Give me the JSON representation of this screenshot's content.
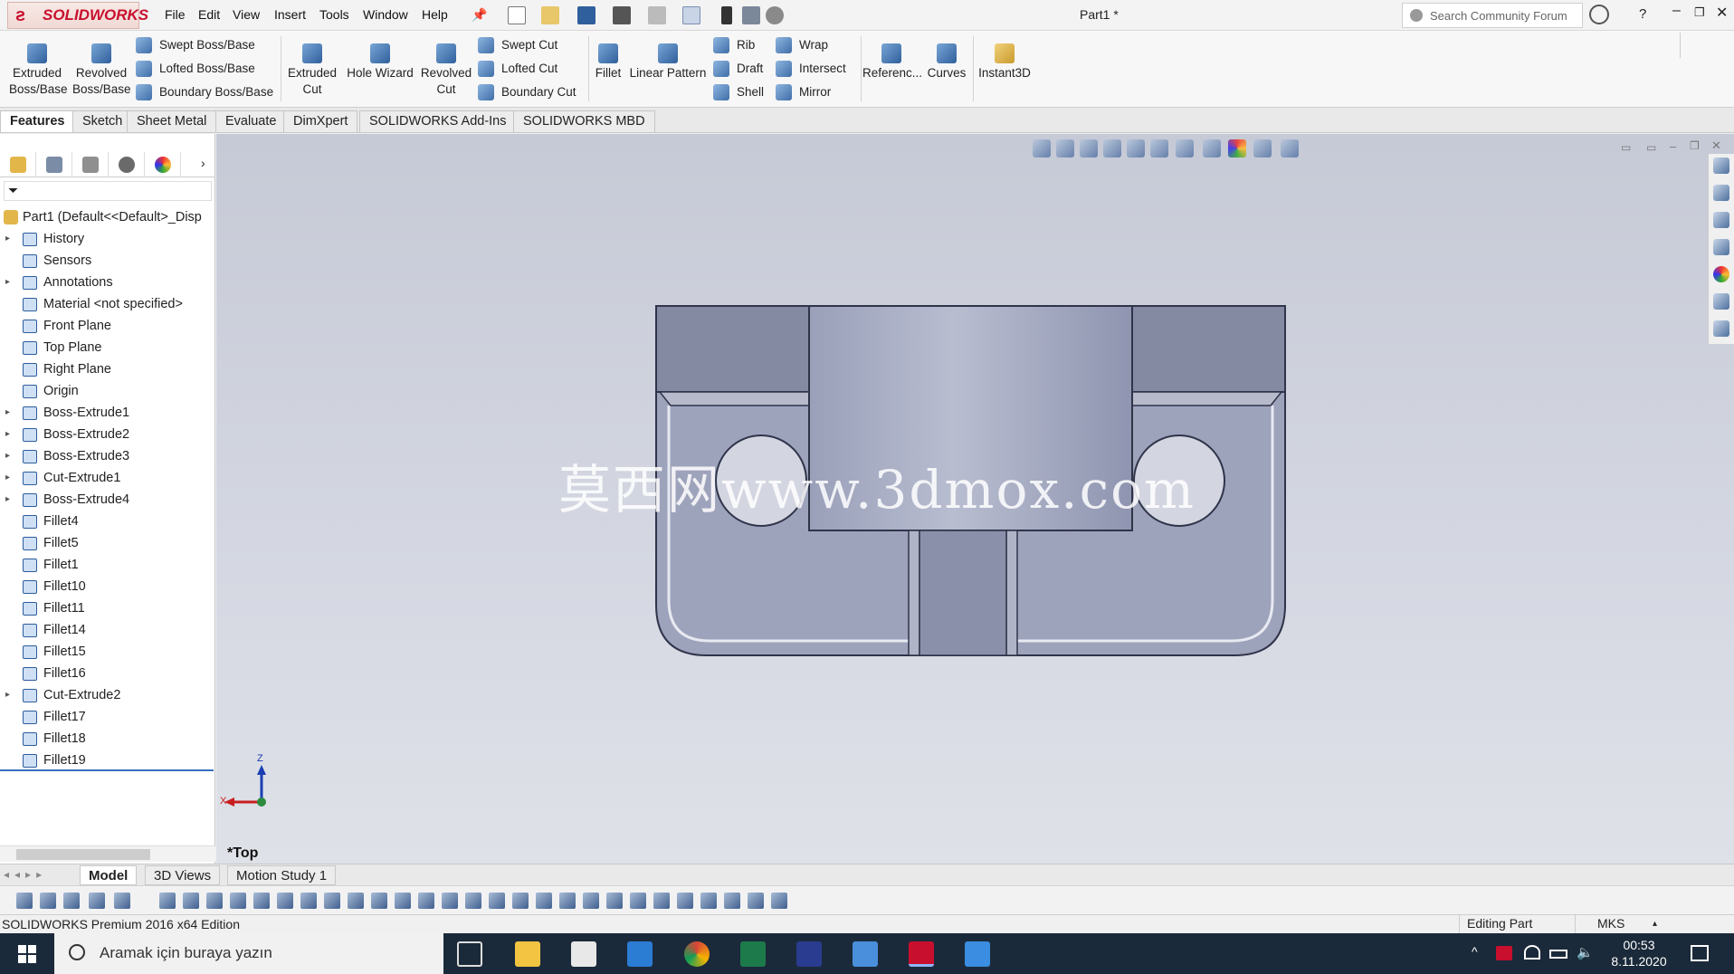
{
  "app": {
    "logo_text": "SOLIDWORKS",
    "document_title": "Part1 *",
    "menu": [
      "File",
      "Edit",
      "View",
      "Insert",
      "Tools",
      "Window",
      "Help"
    ],
    "search_placeholder": "Search Community Forum",
    "help_label": "?"
  },
  "command_manager": {
    "extruded_boss": "Extruded\nBoss/Base",
    "revolved_boss": "Revolved\nBoss/Base",
    "swept_boss": "Swept Boss/Base",
    "lofted_boss": "Lofted Boss/Base",
    "boundary_boss": "Boundary Boss/Base",
    "extruded_cut": "Extruded\nCut",
    "hole_wizard": "Hole Wizard",
    "revolved_cut": "Revolved\nCut",
    "swept_cut": "Swept Cut",
    "lofted_cut": "Lofted Cut",
    "boundary_cut": "Boundary Cut",
    "fillet": "Fillet",
    "linear_pattern": "Linear Pattern",
    "rib": "Rib",
    "draft": "Draft",
    "shell": "Shell",
    "wrap": "Wrap",
    "intersect": "Intersect",
    "mirror": "Mirror",
    "reference": "Referenc...",
    "curves": "Curves",
    "instant3d": "Instant3D"
  },
  "tabs": [
    "Features",
    "Sketch",
    "Sheet Metal",
    "Evaluate",
    "DimXpert",
    "SOLIDWORKS Add-Ins",
    "SOLIDWORKS MBD"
  ],
  "feature_tree": {
    "root": "Part1  (Default<<Default>_Disp",
    "items": [
      {
        "label": "History",
        "expandable": true
      },
      {
        "label": "Sensors",
        "expandable": false
      },
      {
        "label": "Annotations",
        "expandable": true
      },
      {
        "label": "Material <not specified>",
        "expandable": false
      },
      {
        "label": "Front Plane",
        "expandable": false
      },
      {
        "label": "Top Plane",
        "expandable": false
      },
      {
        "label": "Right Plane",
        "expandable": false
      },
      {
        "label": "Origin",
        "expandable": false
      },
      {
        "label": "Boss-Extrude1",
        "expandable": true
      },
      {
        "label": "Boss-Extrude2",
        "expandable": true
      },
      {
        "label": "Boss-Extrude3",
        "expandable": true
      },
      {
        "label": "Cut-Extrude1",
        "expandable": true
      },
      {
        "label": "Boss-Extrude4",
        "expandable": true
      },
      {
        "label": "Fillet4",
        "expandable": false
      },
      {
        "label": "Fillet5",
        "expandable": false
      },
      {
        "label": "Fillet1",
        "expandable": false
      },
      {
        "label": "Fillet10",
        "expandable": false
      },
      {
        "label": "Fillet11",
        "expandable": false
      },
      {
        "label": "Fillet14",
        "expandable": false
      },
      {
        "label": "Fillet15",
        "expandable": false
      },
      {
        "label": "Fillet16",
        "expandable": false
      },
      {
        "label": "Cut-Extrude2",
        "expandable": true
      },
      {
        "label": "Fillet17",
        "expandable": false
      },
      {
        "label": "Fillet18",
        "expandable": false
      },
      {
        "label": "Fillet19",
        "expandable": false
      }
    ]
  },
  "graphics": {
    "view_label": "*Top",
    "watermark": "莫西网www.3dmox.com",
    "triad_z": "Z",
    "triad_x": "X"
  },
  "bottom_tabs": [
    "Model",
    "3D Views",
    "Motion Study 1"
  ],
  "status": {
    "edition": "SOLIDWORKS Premium 2016 x64 Edition",
    "mode": "Editing Part",
    "units": "MKS"
  },
  "taskbar": {
    "search_placeholder": "Aramak için buraya yazın",
    "time": "00:53",
    "date": "8.11.2020"
  },
  "colors": {
    "brand": "#c8102e",
    "part_fill": "#9ea3bc",
    "taskbar": "#1b2a3a"
  }
}
